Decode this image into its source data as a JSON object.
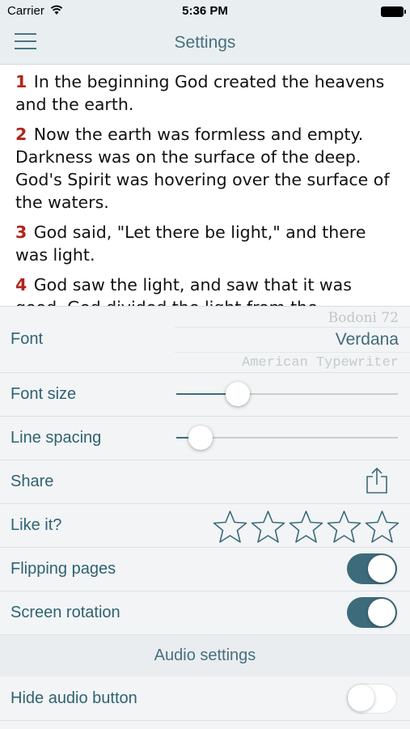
{
  "status_bar": {
    "carrier": "Carrier",
    "time": "5:36 PM"
  },
  "navbar": {
    "title": "Settings"
  },
  "verses": [
    {
      "num": "1",
      "text": "In the beginning God created the heavens and the earth."
    },
    {
      "num": "2",
      "text": "Now the earth was formless and empty. Darkness was on the surface of the deep. God's Spirit was hovering over the surface of the waters."
    },
    {
      "num": "3",
      "text": "God said, \"Let there be light,\" and there was light."
    },
    {
      "num": "4",
      "text": "God saw the light, and saw that it was good. God divided the light from the darkness."
    }
  ],
  "settings": {
    "font": {
      "label": "Font",
      "options_above": "Bodoni 72",
      "selected": "Verdana",
      "options_below": "American Typewriter"
    },
    "font_size": {
      "label": "Font size",
      "value": 0.25
    },
    "line_spacing": {
      "label": "Line spacing",
      "value": 0.06
    },
    "share": {
      "label": "Share",
      "icon": "share-icon"
    },
    "like": {
      "label": "Like it?",
      "rating": 0,
      "max": 5
    },
    "flipping_pages": {
      "label": "Flipping pages",
      "on": true
    },
    "screen_rotation": {
      "label": "Screen rotation",
      "on": true
    }
  },
  "audio": {
    "section_title": "Audio settings",
    "hide_audio_button": {
      "label": "Hide audio button",
      "on": false
    }
  },
  "colors": {
    "accent": "#3d6b7b",
    "verse_number": "#b3231c",
    "bar_background": "#e9eff1",
    "panel_background": "#f2f4f5"
  }
}
